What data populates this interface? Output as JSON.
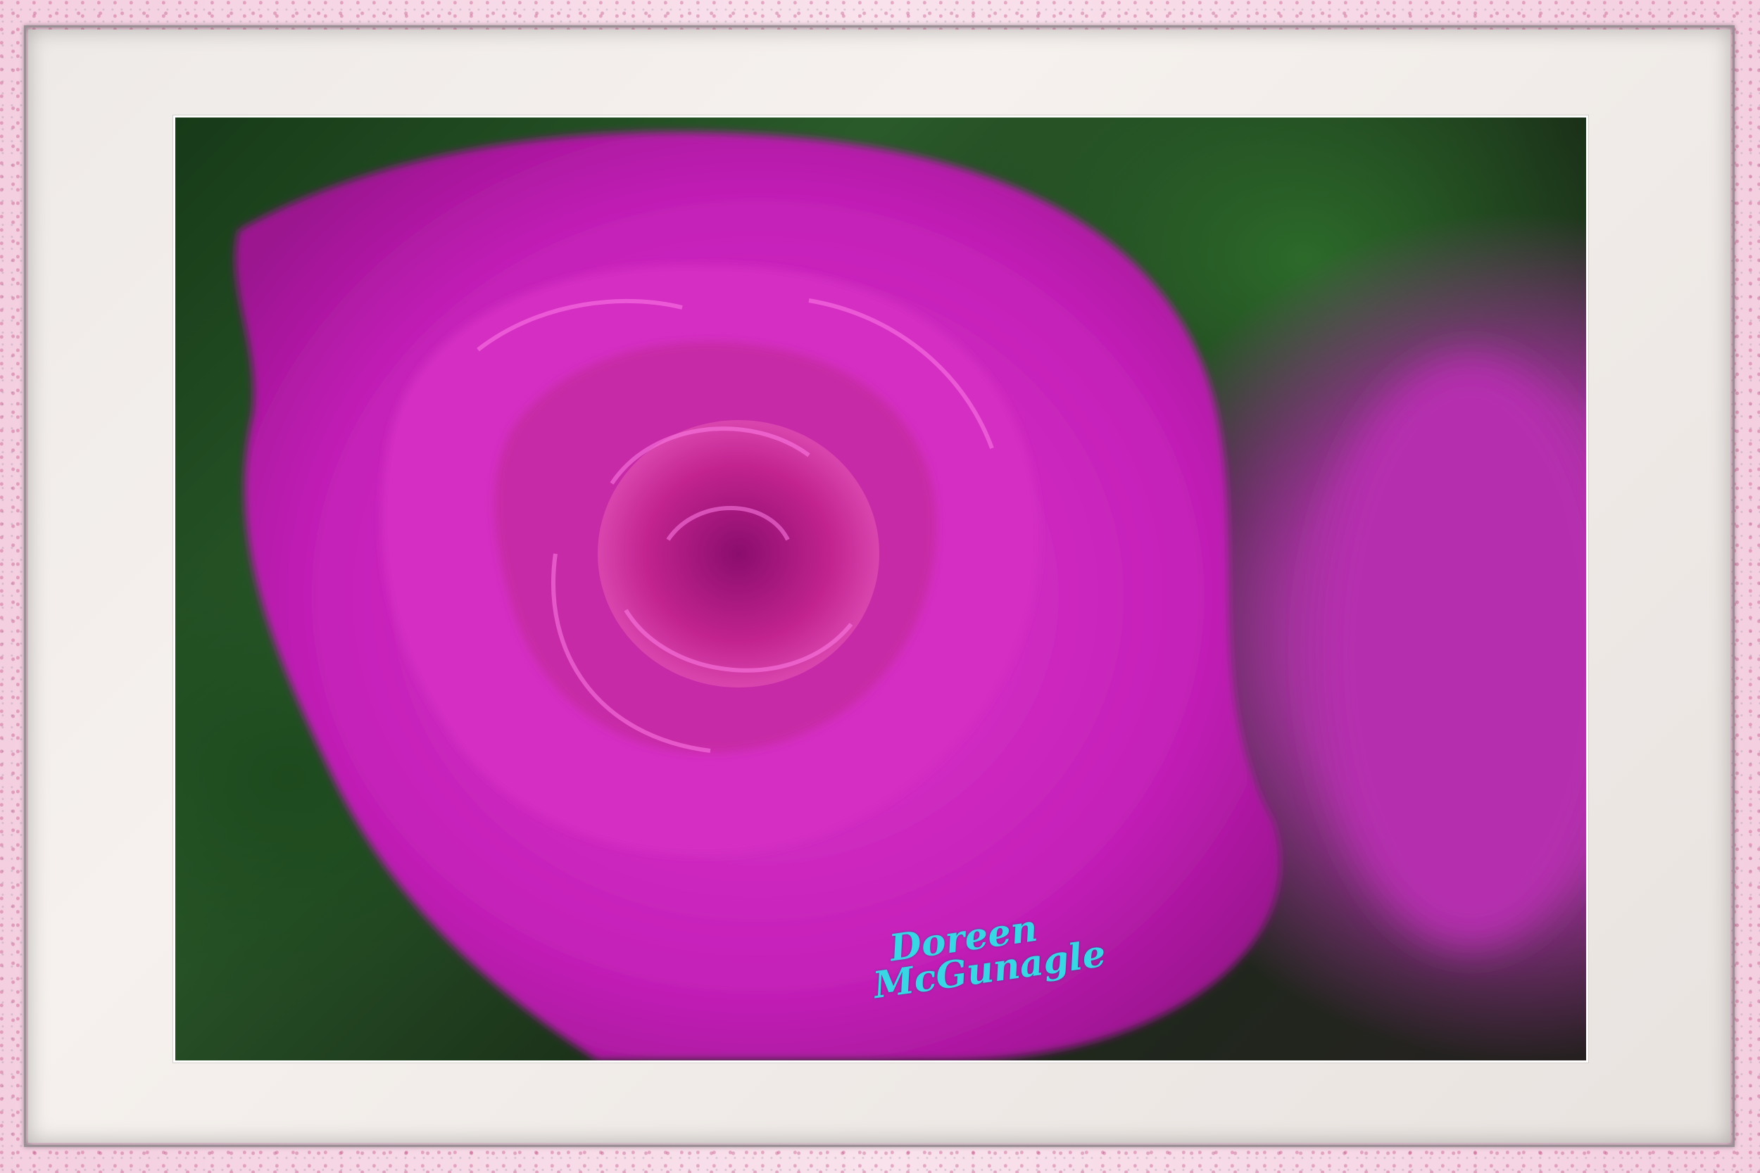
{
  "artwork": {
    "subject": "rose-photo",
    "signature": {
      "line1": "Doreen",
      "line2": "McGunagle"
    }
  },
  "colors": {
    "frame": "#f4cfe0",
    "mat": "#efeae7",
    "rose_main": "#d62fc6",
    "rose_dark": "#a4168f",
    "foliage": "#2a5a2a",
    "signature": "#39d6e6"
  }
}
